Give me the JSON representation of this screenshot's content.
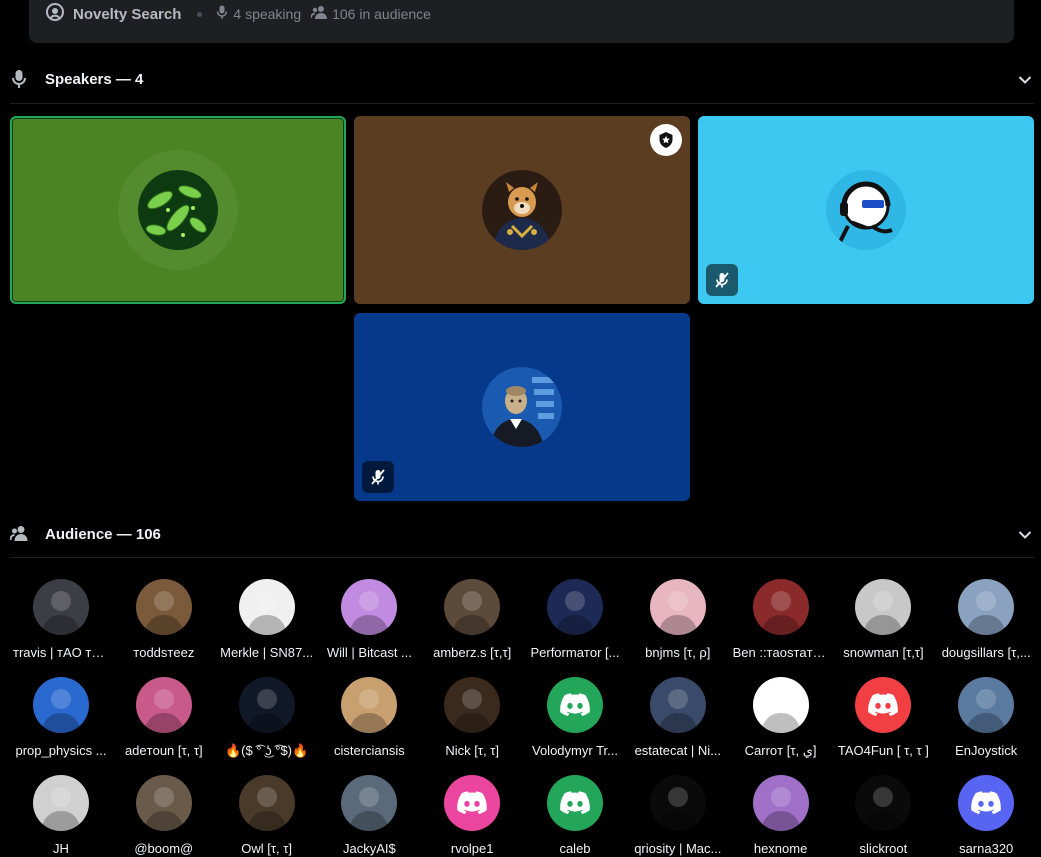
{
  "stage": {
    "title": "Novelty Search",
    "speaking": "4 speaking",
    "audience_count": "106 in audience"
  },
  "speakers_section": {
    "label": "Speakers — 4"
  },
  "audience_section": {
    "label": "Audience — 106"
  },
  "speakers": [
    {
      "id": "speaker-bacteria",
      "bg": "#4a8423",
      "speaking": true,
      "muted": false,
      "moderator": false
    },
    {
      "id": "speaker-doge",
      "bg": "#5b3d21",
      "speaking": false,
      "muted": false,
      "moderator": true
    },
    {
      "id": "speaker-dj",
      "bg": "#3cc8f0",
      "speaking": false,
      "muted": true,
      "moderator": false
    },
    {
      "id": "speaker-stonks",
      "bg": "#06398a",
      "speaking": false,
      "muted": true,
      "moderator": false
    }
  ],
  "audience": [
    {
      "name": "тravis | тAO тe...",
      "color": "#3b3e45"
    },
    {
      "name": "тoddsтeez",
      "color": "#7a5a3a"
    },
    {
      "name": "Merkle | SN87...",
      "color": "#f0f0f0"
    },
    {
      "name": "Will | Bitcast ...",
      "color": "#c08be0"
    },
    {
      "name": "amberz.s [τ,τ]",
      "color": "#5c4a3a"
    },
    {
      "name": "Performaтor [...",
      "color": "#1d2a55"
    },
    {
      "name": "bnjms [τ, ρ]",
      "color": "#e8b6c0"
    },
    {
      "name": "Ben ::тaosтaтs...",
      "color": "#8a2a2a"
    },
    {
      "name": "snowman [τ,τ]",
      "color": "#c8c8c8"
    },
    {
      "name": "dougsillars [τ,...",
      "color": "#8aa2c0"
    },
    {
      "name": "prop_physics ...",
      "color": "#2a6ad0"
    },
    {
      "name": "adeтoun [τ, τ]",
      "color": "#c85a8a"
    },
    {
      "name": "🔥($ ͡° ͜ʖ ͡°$)🔥",
      "color": "#111827"
    },
    {
      "name": "cisterciansis",
      "color": "#c8a070"
    },
    {
      "name": "Nick [τ, τ]",
      "color": "#3a2a1e"
    },
    {
      "name": "Volodymyr Tr...",
      "color": "#23a55a",
      "discord": true
    },
    {
      "name": "estatecat | Ni...",
      "color": "#3a4a6a"
    },
    {
      "name": "Carroт [τ, ي]",
      "color": "#ffffff"
    },
    {
      "name": "TAO4Fun [ τ, τ ]",
      "color": "#f23f43",
      "discord": true
    },
    {
      "name": "EnJoystick",
      "color": "#5a7aa0"
    },
    {
      "name": "JH",
      "color": "#d0d0d0"
    },
    {
      "name": "@boom@",
      "color": "#6a5a4a"
    },
    {
      "name": "Owl [τ, τ]",
      "color": "#4a3a2a"
    },
    {
      "name": "JackyAI$",
      "color": "#5a6a7a"
    },
    {
      "name": "rvolpe1",
      "color": "#eb459f",
      "discord": true
    },
    {
      "name": "caleb",
      "color": "#23a55a",
      "discord": true
    },
    {
      "name": "qriosity | Mac...",
      "color": "#0a0a0a"
    },
    {
      "name": "hexnome",
      "color": "#a070c8"
    },
    {
      "name": "slickroot",
      "color": "#0a0a0a"
    },
    {
      "name": "sarna320",
      "color": "#5865f2",
      "discord": true
    }
  ]
}
